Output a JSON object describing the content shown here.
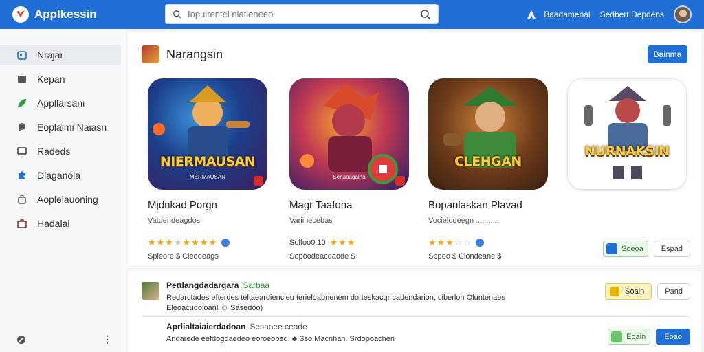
{
  "app": {
    "name": "Applkessin",
    "brand_color": "#1f6fd6"
  },
  "search": {
    "placeholder": "Iopuirentel niatieneeo"
  },
  "header": {
    "link1": "Baadamenal",
    "link2": "Sedbert Depdens"
  },
  "sidebar": {
    "items": [
      {
        "label": "Nrajar",
        "icon": "calendar-icon"
      },
      {
        "label": "Kepan",
        "icon": "folder-icon"
      },
      {
        "label": "Appllarsani",
        "icon": "leaf-icon"
      },
      {
        "label": "Eoplaimi Naiasn",
        "icon": "chat-icon"
      },
      {
        "label": "Radeds",
        "icon": "screen-icon"
      },
      {
        "label": "Dlaganoia",
        "icon": "puzzle-icon"
      },
      {
        "label": "Aoplelauoning",
        "icon": "bag-icon"
      },
      {
        "label": "Hadalai",
        "icon": "briefcase-icon"
      }
    ]
  },
  "featured": {
    "title": "Narangsin",
    "button": "Bainma",
    "apps": [
      {
        "art_title": "NIERMAUSAN",
        "art_sub": "MERMAUSAN",
        "name": "Mjdnkad Porgn",
        "developer": "Vatdendeagdos",
        "rating_stars": 4.5,
        "meta": "Spleore  $  Cleodeags"
      },
      {
        "art_title": "",
        "art_sub": "Senaoagaina",
        "name": "Magr Taafona",
        "developer": "Variinecebas",
        "rating_prefix": "Solfoo0:10",
        "rating_stars": 3,
        "meta": "Sopoodeacdaode  $"
      },
      {
        "art_title": "CLEHGAN",
        "art_sub": "",
        "name": "Bopanlaskan Plavad",
        "developer": "Vocielodeegn  ...........",
        "rating_stars": 3,
        "meta": "Sppoo  $  Clondeane  $"
      },
      {
        "art_title": "NURNAKSIN",
        "art_sub": "",
        "name": "",
        "developer": "",
        "rating_stars": 0,
        "meta": ""
      }
    ],
    "actions": {
      "green": "Soeoa",
      "outline": "Espad"
    }
  },
  "list": [
    {
      "title": "Pettlangdadargara",
      "tag": "Sarbaa",
      "desc": "Redarctades  efterdes teltaeardiencleu terieloabnenem  dorteskacqr cadendarion,  ciberlon Oluntenaes  Eleoacudoloan!  ☺  Sasedoo)",
      "btn1": "Soain",
      "btn2": "Pand"
    },
    {
      "title": "Aprlialtaiaierdadoan",
      "tag": "Sesnoee  ceade",
      "desc": "Andarede  eefdogdaedeo  eoroeobed.  ♣  Sso Macnhan. Srdopoachen",
      "btn1": "Eoain",
      "btn2": "Eoao"
    }
  ]
}
